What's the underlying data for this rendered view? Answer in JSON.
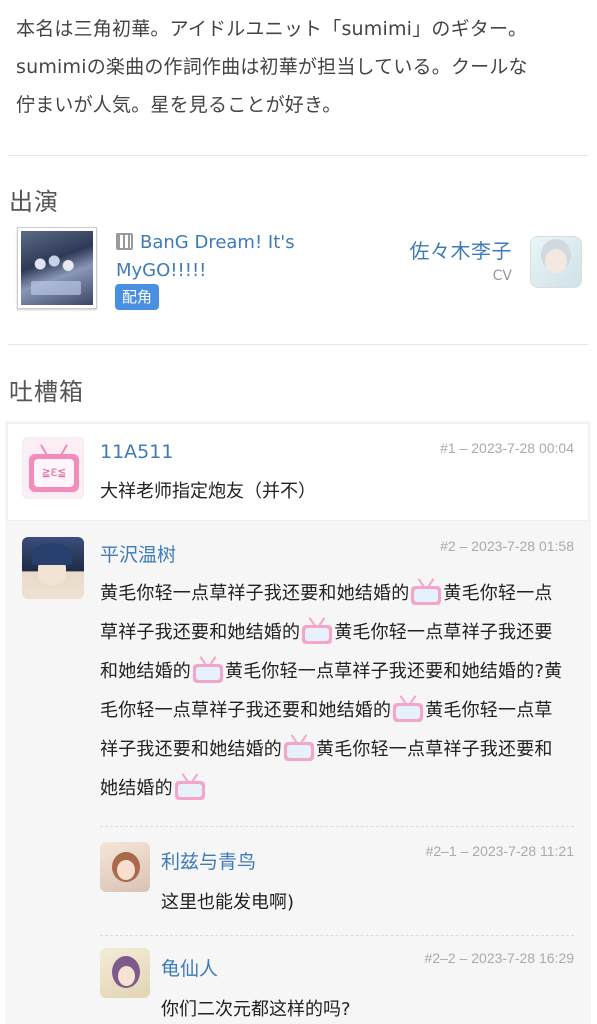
{
  "intro": {
    "line1": "本名は三角初華。アイドルユニット「sumimi」のギター。",
    "line2": "sumimiの楽曲の作詞作曲は初華が担当している。クールな",
    "line3": "佇まいが人気。星を見ることが好き。"
  },
  "cast": {
    "title": "出演",
    "work_title": "BanG Dream! It's MyGO!!!!!",
    "role_badge": "配角",
    "cv_name": "佐々木李子",
    "cv_label": "CV"
  },
  "comments": {
    "title": "吐槽箱",
    "icons": {
      "emoji": "bilibili-tv-emoji-icon",
      "film": "film-icon"
    },
    "posts": [
      {
        "user": "11A511",
        "meta": "#1 – 2023-7-28 00:04",
        "text": "大祥老师指定炮友（并不）",
        "avatar_face": "≧ε≦"
      },
      {
        "user": "平沢温树",
        "meta": "#2 – 2023-7-28 01:58",
        "segments": [
          "黄毛你轻一点草祥子我还要和她结婚的",
          "黄毛你轻一点草祥子我还要和她结婚的",
          "黄毛你轻一点草祥子我还要和她结婚的",
          "黄毛你轻一点草祥子我还要和她结婚的?黄毛你轻一点草祥子我还要和她结婚的",
          "黄毛你轻一点草祥子我还要和她结婚的",
          "黄毛你轻一点草祥子我还要和她结婚的"
        ],
        "replies": [
          {
            "user": "利兹与青鸟",
            "meta": "#2–1 – 2023-7-28 11:21",
            "text": "这里也能发电啊)"
          },
          {
            "user": "龟仙人",
            "meta": "#2–2 – 2023-7-28 16:29",
            "text": "你们二次元都这样的吗?"
          }
        ]
      }
    ]
  }
}
